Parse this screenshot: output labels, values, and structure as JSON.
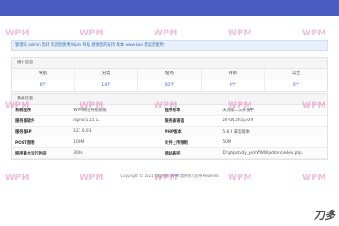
{
  "notice": "管理员 admin 您好 欢迎您使用 Wpm 导航 感谢您的支持 版本 www.hao 建议您使用",
  "stats": {
    "title": "统计信息",
    "headers": [
      "导航",
      "分类",
      "站点",
      "待审",
      "公告"
    ],
    "values": [
      "6个",
      "14个",
      "60个",
      "0个",
      "0个"
    ]
  },
  "sysinfo": {
    "title": "系统信息",
    "rows": [
      [
        "系统程序",
        "WPM网址导航系统",
        "程序版本",
        "天龙第二天开发中"
      ],
      [
        "服务器软件",
        "nginx/1.15.11",
        "服务器语言",
        "zh-CN,zh;q=0.9"
      ],
      [
        "服务器IP",
        "127.0.0.1",
        "PHP版本",
        "5.6.9 安装版本"
      ],
      [
        "POST限制",
        "100M",
        "文件上传限制",
        "50M"
      ],
      [
        "程序最大运行时间",
        "300s",
        "网站路径",
        "D:\\phpstudy_pro\\WWW\\admin\\index.php"
      ]
    ]
  },
  "footer": {
    "prefix": "Copyright © 2021 本程序由 ",
    "link": "WPM",
    "suffix": " 提供技术支持 Powered"
  },
  "watermark": "WPM",
  "corner_mark": "刀多"
}
